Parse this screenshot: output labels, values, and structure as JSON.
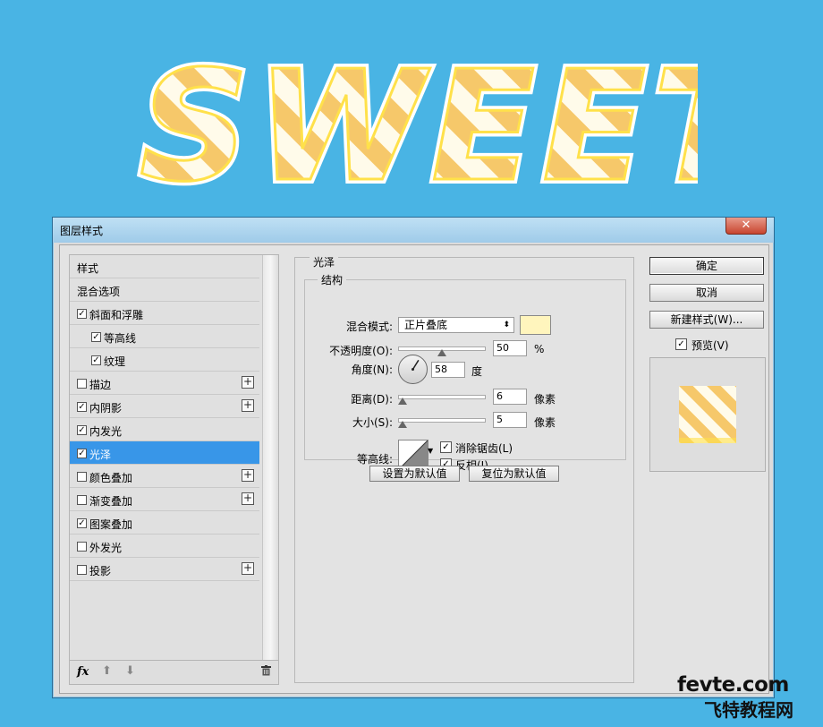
{
  "artwork": {
    "text": "SWEET",
    "colors": {
      "fill": "#fffbea",
      "stripe": "#f6c86a",
      "outline": "#ffe14a"
    }
  },
  "dialog": {
    "title": "图层样式",
    "close_label": "✕"
  },
  "styles_list": {
    "header": "样式",
    "blend_options": "混合选项",
    "items": [
      {
        "label": "斜面和浮雕",
        "checked": true,
        "indent": 0,
        "plus": false
      },
      {
        "label": "等高线",
        "checked": true,
        "indent": 1,
        "plus": false
      },
      {
        "label": "纹理",
        "checked": true,
        "indent": 1,
        "plus": false
      },
      {
        "label": "描边",
        "checked": false,
        "indent": 0,
        "plus": true
      },
      {
        "label": "内阴影",
        "checked": true,
        "indent": 0,
        "plus": true
      },
      {
        "label": "内发光",
        "checked": true,
        "indent": 0,
        "plus": false
      },
      {
        "label": "光泽",
        "checked": true,
        "indent": 0,
        "plus": false,
        "selected": true
      },
      {
        "label": "颜色叠加",
        "checked": false,
        "indent": 0,
        "plus": true
      },
      {
        "label": "渐变叠加",
        "checked": false,
        "indent": 0,
        "plus": true
      },
      {
        "label": "图案叠加",
        "checked": true,
        "indent": 0,
        "plus": false
      },
      {
        "label": "外发光",
        "checked": false,
        "indent": 0,
        "plus": false
      },
      {
        "label": "投影",
        "checked": false,
        "indent": 0,
        "plus": true
      }
    ],
    "footer": {
      "fx": "fx",
      "up": "⬆",
      "down": "⬇"
    },
    "check_mark": "✓",
    "plus_mark": "+"
  },
  "satin": {
    "section_title": "光泽",
    "group_title": "结构",
    "blend_mode_label": "混合模式:",
    "blend_mode_value": "正片叠底",
    "blend_mode_caret": "⬍",
    "color": "#fff5bd",
    "opacity_label": "不透明度(O):",
    "opacity_value": "50",
    "opacity_unit": "%",
    "opacity_fraction": 0.5,
    "angle_label": "角度(N):",
    "angle_value": "58",
    "angle_unit": "度",
    "distance_label": "距离(D):",
    "distance_value": "6",
    "distance_unit": "像素",
    "size_label": "大小(S):",
    "size_value": "5",
    "size_unit": "像素",
    "contour_label": "等高线:",
    "antialias_label": "消除锯齿(L)",
    "antialias_checked": true,
    "invert_label": "反相(I)",
    "invert_checked": true,
    "make_default": "设置为默认值",
    "reset_default": "复位为默认值"
  },
  "actions": {
    "ok": "确定",
    "cancel": "取消",
    "new_style": "新建样式(W)...",
    "preview_label": "预览(V)",
    "preview_checked": true
  },
  "watermark": {
    "line1": "fevte.com",
    "line2": "飞特教程网"
  }
}
